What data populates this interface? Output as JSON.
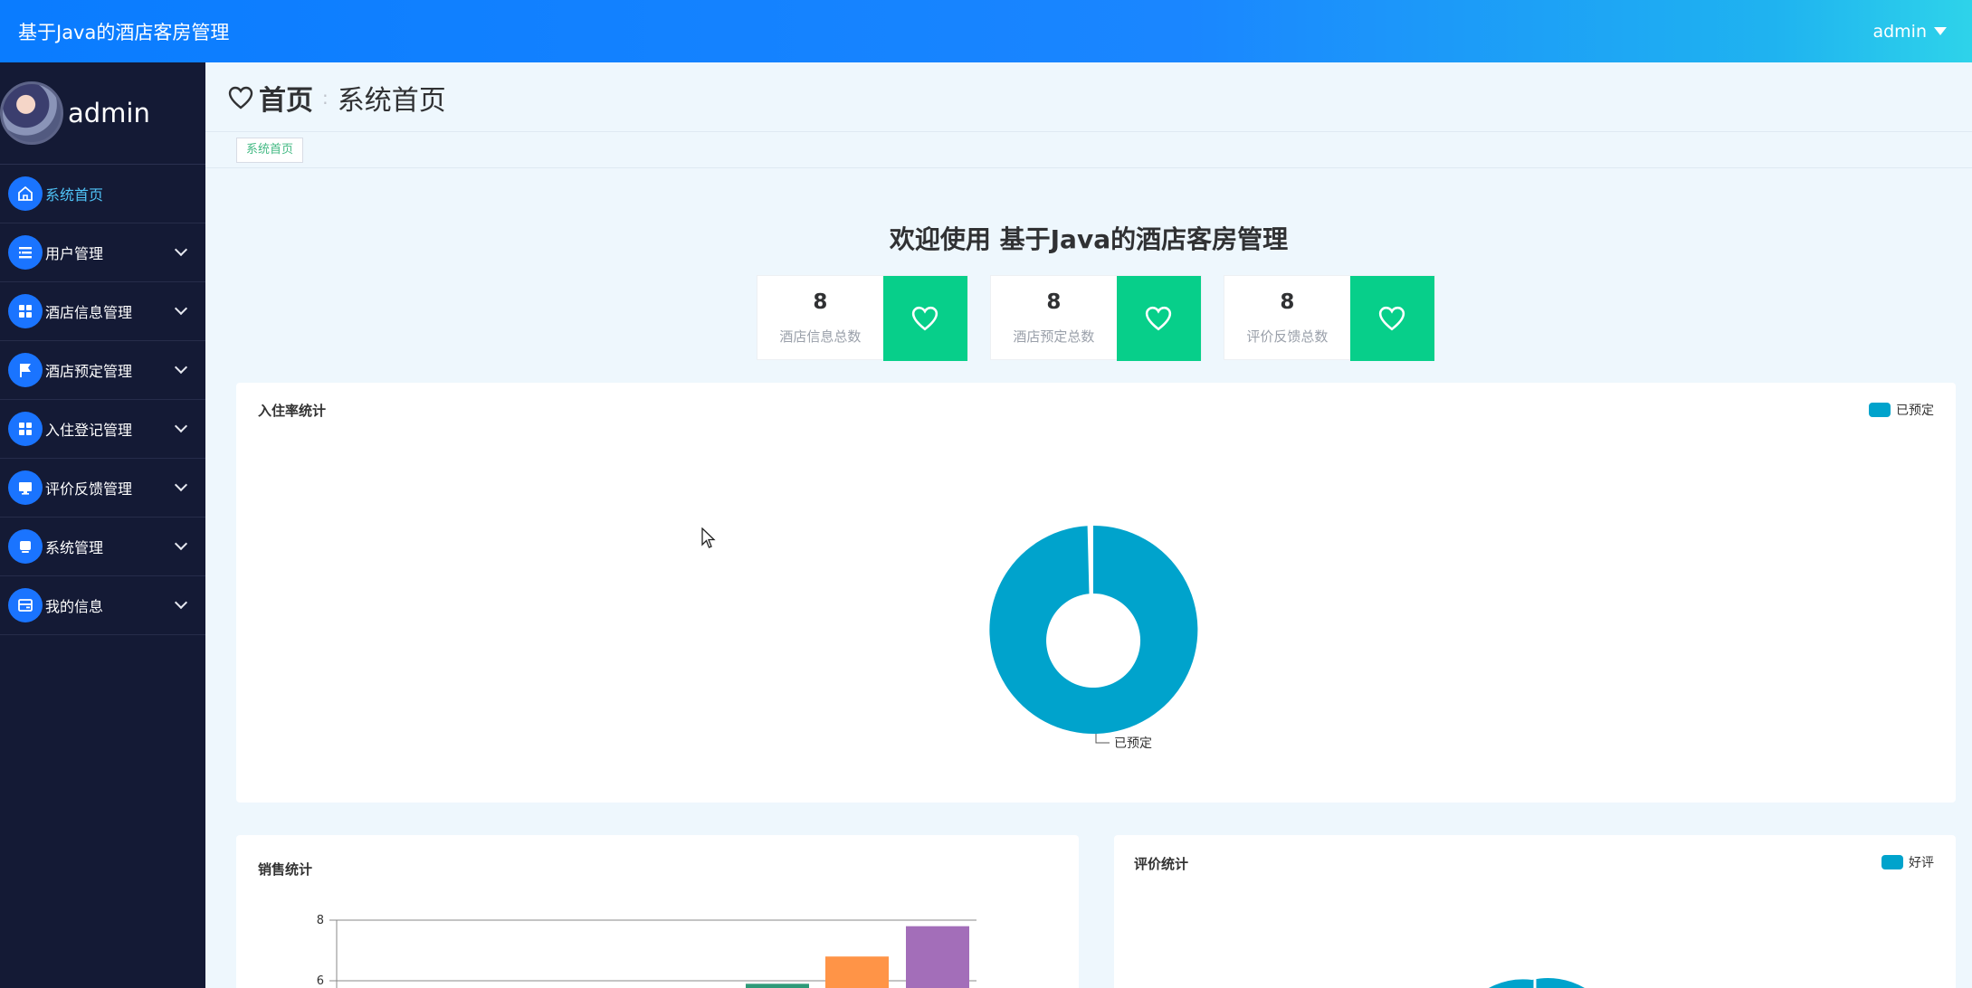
{
  "header": {
    "app_title": "基于Java的酒店客房管理",
    "user": "admin"
  },
  "sidebar": {
    "profile_name": "admin",
    "items": [
      {
        "label": "系统首页",
        "icon": "home-icon",
        "active": true
      },
      {
        "label": "用户管理",
        "icon": "list-icon"
      },
      {
        "label": "酒店信息管理",
        "icon": "grid-icon"
      },
      {
        "label": "酒店预定管理",
        "icon": "flag-icon"
      },
      {
        "label": "入住登记管理",
        "icon": "grid-icon"
      },
      {
        "label": "评价反馈管理",
        "icon": "monitor-icon"
      },
      {
        "label": "系统管理",
        "icon": "device-icon"
      },
      {
        "label": "我的信息",
        "icon": "card-icon"
      }
    ]
  },
  "breadcrumb": {
    "home": "首页",
    "current": "系统首页"
  },
  "tabs": [
    {
      "label": "系统首页"
    }
  ],
  "welcome": "欢迎使用 基于Java的酒店客房管理",
  "stats": [
    {
      "value": "8",
      "label": "酒店信息总数"
    },
    {
      "value": "8",
      "label": "酒店预定总数"
    },
    {
      "value": "8",
      "label": "评价反馈总数"
    }
  ],
  "panels": {
    "occupancy": {
      "title": "入住率统计",
      "legend": "已预定",
      "slice_label": "已预定"
    },
    "sales": {
      "title": "销售统计"
    },
    "reviews": {
      "title": "评价统计",
      "legend": "好评"
    }
  },
  "colors": {
    "accent": "#1a74ff",
    "stat_icon_bg": "#07cf8a",
    "chart_primary": "#00a3cc"
  },
  "chart_data": [
    {
      "type": "pie",
      "title": "入住率统计",
      "style": "donut",
      "legend": "top-right",
      "slices": [
        {
          "name": "已预定",
          "value": 1
        }
      ]
    },
    {
      "type": "bar",
      "title": "销售统计",
      "yticks": [
        6,
        8
      ],
      "grid": true,
      "bars": [
        {
          "value": 5.9,
          "color": "#2e9a78"
        },
        {
          "value": 6.8,
          "color": "#ff9447"
        },
        {
          "value": 7.8,
          "color": "#a36eb9"
        }
      ]
    },
    {
      "type": "pie",
      "title": "评价统计",
      "legend": "top-right",
      "slices": [
        {
          "name": "好评",
          "value": 1
        }
      ]
    }
  ]
}
